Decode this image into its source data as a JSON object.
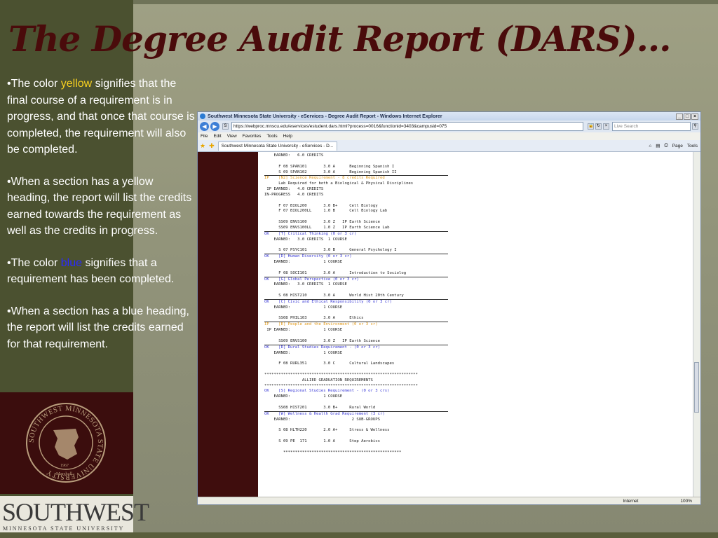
{
  "slide": {
    "title": "The Degree Audit Report (DARS)…",
    "bullets": [
      {
        "before": "•The color ",
        "highlight": "yellow",
        "after": " signifies that the final course of a requirement is in progress, and that once that course is completed, the requirement will also be completed."
      },
      {
        "text": "•When a section has a yellow heading, the report will list the credits earned towards the requirement as well as the credits in progress."
      },
      {
        "before": "•The color ",
        "highlight": "blue",
        "after": " signifies that a requirement has been completed."
      },
      {
        "text": "•When a section has a blue heading, the report will list the credits earned for that requirement."
      }
    ],
    "seal_text": "SOUTHWEST MINNESOTA STATE UNIVERSITY",
    "seal_year": "1967",
    "seal_city": "Marshall",
    "logo_main": "SOUTHWEST",
    "logo_sub": "MINNESOTA STATE UNIVERSITY",
    "colors": {
      "title": "#4a0b0b",
      "panel": "#3b0d0d",
      "yellow": "#f7d020",
      "blue": "#2a2aff"
    }
  },
  "browser": {
    "window_title": "Southwest Minnesota State University - eServices - Degree Audit Report - Windows Internet Explorer",
    "address": "https://webproc.mnscu.edu/eservices/estudent.dars.html?process=0016&functionid=3403&campusid=075",
    "search_placeholder": "Live Search",
    "menu": [
      "File",
      "Edit",
      "View",
      "Favorites",
      "Tools",
      "Help"
    ],
    "tab_label": "Southwest Minnesota State University - eServices - D...",
    "tools_page": "Page",
    "tools_tools": "Tools",
    "status_zone": "Internet",
    "status_zoom": "100%",
    "report_lines": [
      {
        "t": "    EARNED:   6.0 CREDITS",
        "c": ""
      },
      {
        "t": "",
        "c": ""
      },
      {
        "t": "      F 08 SPAN101       3.0 A      Beginning Spanish I",
        "c": ""
      },
      {
        "t": "      S 09 SPAN102       3.0 A      Beginning Spanish II",
        "c": ""
      },
      {
        "t": "",
        "c": "rule"
      },
      {
        "t": "IP    [N2] Science Requirement - 8 credits Required",
        "c": "y"
      },
      {
        "t": "      Lab Required for both a Biological & Physical Disciplines",
        "c": ""
      },
      {
        "t": " IP EARNED:   4.0 CREDITS",
        "c": ""
      },
      {
        "t": "IN-PROGRESS   4.0 CREDITS",
        "c": ""
      },
      {
        "t": "",
        "c": ""
      },
      {
        "t": "      F 07 BIOL200       3.0 B+     Cell Biology",
        "c": ""
      },
      {
        "t": "      F 07 BIOL200LL     1.0 B      Cell Biology Lab",
        "c": ""
      },
      {
        "t": "",
        "c": ""
      },
      {
        "t": "      SS09 ENVS100       3.0 Z   IP Earth Science",
        "c": ""
      },
      {
        "t": "      SS09 ENVS100LL     1.0 Z   IP Earth Science Lab",
        "c": ""
      },
      {
        "t": "",
        "c": "rule"
      },
      {
        "t": "OK    [T] Critical Thinking (0 or 3 cr)",
        "c": "b"
      },
      {
        "t": "    EARNED:   3.0 CREDITS  1 COURSE",
        "c": ""
      },
      {
        "t": "",
        "c": ""
      },
      {
        "t": "      S 07 PSYC101       3.0 B      General Psychology I",
        "c": ""
      },
      {
        "t": "",
        "c": "rule"
      },
      {
        "t": "OK    [D] Human Diversity (0 or 3 cr)",
        "c": "b"
      },
      {
        "t": "    EARNED:              1 COURSE",
        "c": ""
      },
      {
        "t": "",
        "c": ""
      },
      {
        "t": "      F 08 SOCI101       3.0 A      Introduction to Sociolog",
        "c": ""
      },
      {
        "t": "",
        "c": "rule"
      },
      {
        "t": "OK    [G] Global Perspective (0 or 3 cr)",
        "c": "b"
      },
      {
        "t": "    EARNED:   3.0 CREDITS  1 COURSE",
        "c": ""
      },
      {
        "t": "",
        "c": ""
      },
      {
        "t": "      S 08 HIST210       3.0 A      World Hist 20th Century",
        "c": ""
      },
      {
        "t": "",
        "c": "rule"
      },
      {
        "t": "OK    [C] Civic and Ethical Responsibility (0 or 3 cr)",
        "c": "b"
      },
      {
        "t": "    EARNED:              1 COURSE",
        "c": ""
      },
      {
        "t": "",
        "c": ""
      },
      {
        "t": "      SS08 PHIL103       3.0 A      Ethics",
        "c": ""
      },
      {
        "t": "",
        "c": "rule"
      },
      {
        "t": "IP    [E] People and the Environment (0 or 3 cr)",
        "c": "y"
      },
      {
        "t": " IP EARNED:              1 COURSE",
        "c": ""
      },
      {
        "t": "",
        "c": ""
      },
      {
        "t": "      SS09 ENVS100       3.0 Z   IP Earth Science",
        "c": ""
      },
      {
        "t": "",
        "c": "rule"
      },
      {
        "t": "OK    [R] Rural Studies Requirement - (0 or 3 cr)",
        "c": "b"
      },
      {
        "t": "    EARNED:              1 COURSE",
        "c": ""
      },
      {
        "t": "",
        "c": ""
      },
      {
        "t": "      F 08 RURL351       3.0 C      Cultural Landscapes",
        "c": ""
      },
      {
        "t": "",
        "c": ""
      },
      {
        "t": "*****************************************************************",
        "c": ""
      },
      {
        "t": "                ALLIED GRADUATION REQUIREMENTS",
        "c": ""
      },
      {
        "t": "*****************************************************************",
        "c": ""
      },
      {
        "t": "OK    [S] Regional Studies Requirement - (0 or 3 crs)",
        "c": "b"
      },
      {
        "t": "    EARNED:              1 COURSE",
        "c": ""
      },
      {
        "t": "",
        "c": ""
      },
      {
        "t": "      SS08 HIST201       3.0 B+     Rural World",
        "c": ""
      },
      {
        "t": "",
        "c": "rule"
      },
      {
        "t": "OK    [W] Wellness & Health Grad Requirement (3 cr)",
        "c": "b"
      },
      {
        "t": "    EARNED:                          2 SUB-GROUPS",
        "c": ""
      },
      {
        "t": "",
        "c": ""
      },
      {
        "t": "      S 08 HLTH220       2.0 A+     Stress & Wellness",
        "c": ""
      },
      {
        "t": "",
        "c": ""
      },
      {
        "t": "      S 09 PE  171       1.0 A      Step Aerobics",
        "c": ""
      },
      {
        "t": "",
        "c": ""
      },
      {
        "t": "        **************************************************",
        "c": ""
      }
    ]
  }
}
